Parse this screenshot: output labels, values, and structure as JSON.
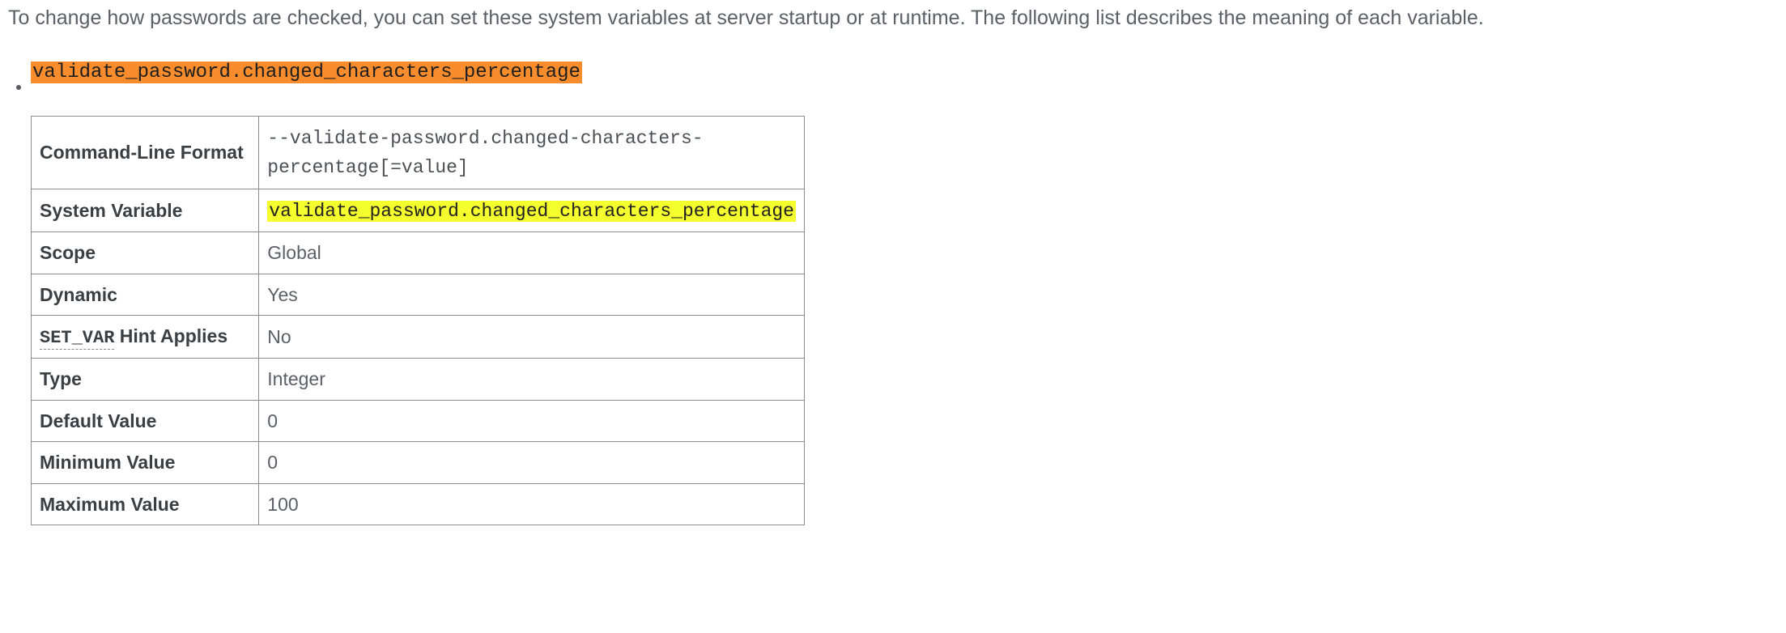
{
  "intro_text": "To change how passwords are checked, you can set these system variables at server startup or at runtime. The following list describes the meaning of each variable.",
  "variable_name": "validate_password.changed_characters_percentage",
  "table": {
    "rows": [
      {
        "label": "Command-Line Format",
        "value_mono": "--validate-password.changed-characters-percentage[=value]"
      },
      {
        "label": "System Variable",
        "value_sysvar": "validate_password.changed_characters_percentage"
      },
      {
        "label": "Scope",
        "value": "Global"
      },
      {
        "label": "Dynamic",
        "value": "Yes"
      },
      {
        "label_setvar_prefix": "SET_VAR",
        "label_setvar_suffix": " Hint Applies",
        "value": "No"
      },
      {
        "label": "Type",
        "value": "Integer"
      },
      {
        "label": "Default Value",
        "value": "0"
      },
      {
        "label": "Minimum Value",
        "value": "0"
      },
      {
        "label": "Maximum Value",
        "value": "100"
      }
    ]
  }
}
